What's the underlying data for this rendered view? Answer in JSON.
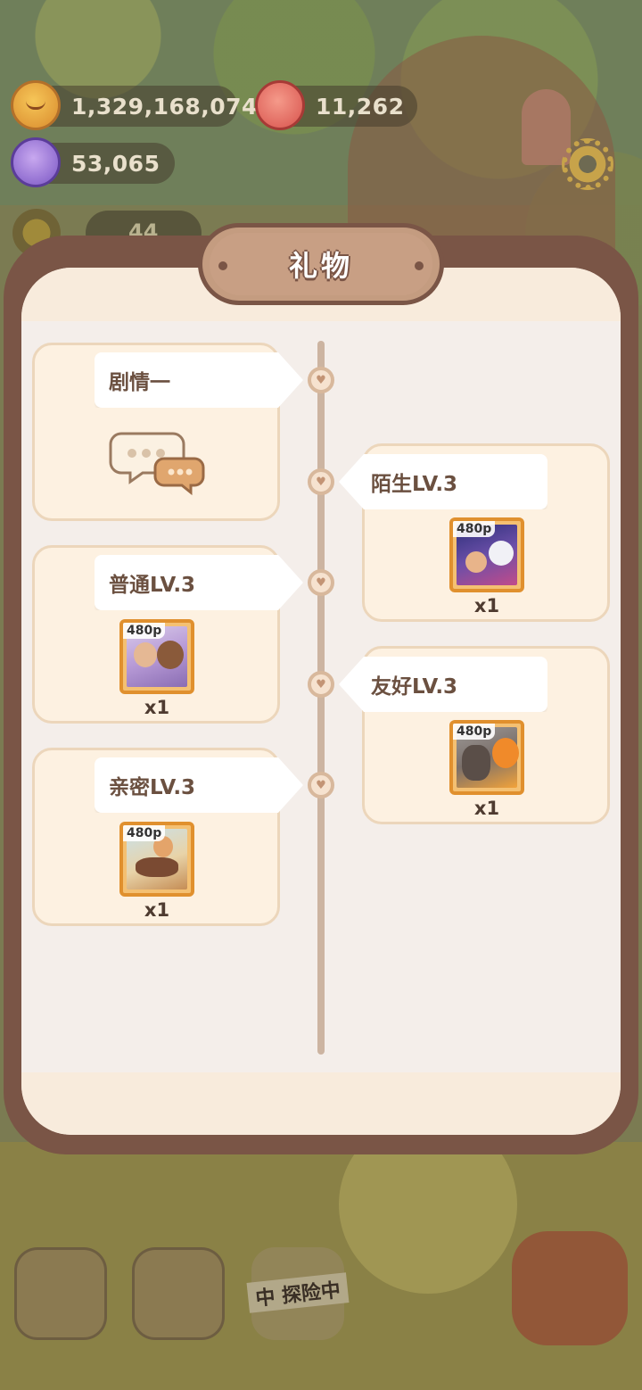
{
  "currencies": {
    "coins": "1,329,168,074",
    "berries": "11,262",
    "gems": "53,065"
  },
  "side_counter": "44",
  "dialog": {
    "title": "礼物"
  },
  "timeline": {
    "story_tag": "剧情一",
    "milestones": [
      {
        "label": "陌生LV.3",
        "resolution": "480p",
        "quantity": "x1"
      },
      {
        "label": "普通LV.3",
        "resolution": "480p",
        "quantity": "x1"
      },
      {
        "label": "友好LV.3",
        "resolution": "480p",
        "quantity": "x1"
      },
      {
        "label": "亲密LV.3",
        "resolution": "480p",
        "quantity": "x1"
      }
    ]
  },
  "dock": {
    "explore_label": "中 探险中"
  },
  "colors": {
    "panel_border": "#7a5546",
    "card_bg": "#fdf1e1",
    "reward_frame": "#e0902e"
  }
}
